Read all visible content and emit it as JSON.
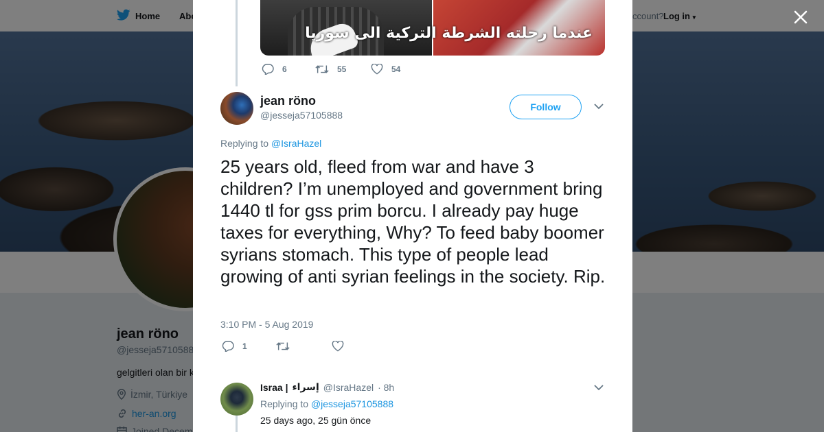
{
  "background_page": {
    "nav": {
      "home_label": "Home",
      "about_label": "Abo",
      "account_label": "ccount?",
      "login_label": "Log in"
    },
    "profile": {
      "name": "jean röno",
      "handle": "@jesseja5710588",
      "bio": "gelgitleri olan bir k",
      "location": "İzmir, Türkiye",
      "link": "her-an.org",
      "joined": "Joined Decem"
    }
  },
  "modal": {
    "previous_tweet": {
      "media_caption": "عندما رحلته الشرطة التركية الى سوريا",
      "reply_count": "6",
      "retweet_count": "55",
      "like_count": "54"
    },
    "main_tweet": {
      "name": "jean röno",
      "handle": "@jesseja57105888",
      "follow_label": "Follow",
      "replying_prefix": "Replying to",
      "replying_to": "@IsraHazel",
      "text": "25 years old, fleed from war and have 3 children? I’m unemployed and government bring 1440 tl for gss prim borcu. I already pay huge taxes for everything, Why? To feed baby boomer syrians stomach. This type of people lead growing of anti syrian feelings in the society. Rip.",
      "timestamp": "3:10 PM - 5 Aug 2019",
      "reply_count": "1",
      "retweet_count": "",
      "like_count": ""
    },
    "reply_tweet": {
      "name": "Israa |",
      "name_rtl": "إسراء",
      "handle": "@IsraHazel",
      "time": "· 8h",
      "replying_prefix": "Replying to",
      "replying_to": "@jesseja57105888",
      "text": "25 days ago, 25 gün önce"
    }
  },
  "colors": {
    "accent": "#1da1f2",
    "link": "#1b95e0",
    "muted": "#657786",
    "text": "#14171a"
  },
  "icons": [
    "twitter-bird-icon",
    "close-icon",
    "reply-icon",
    "retweet-icon",
    "like-icon",
    "chevron-down-icon",
    "location-icon",
    "link-icon",
    "calendar-icon"
  ]
}
